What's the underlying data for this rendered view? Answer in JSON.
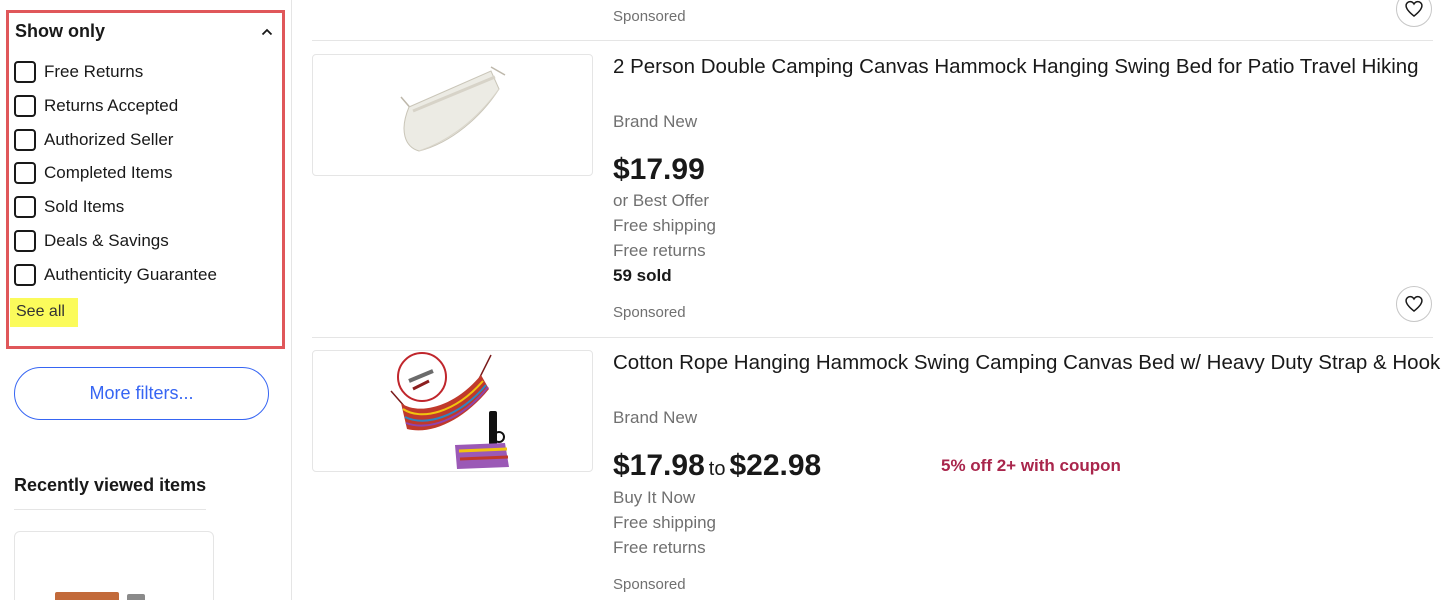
{
  "sidebar": {
    "filter_title": "Show only",
    "options": [
      {
        "label": "Free Returns",
        "checked": false
      },
      {
        "label": "Returns Accepted",
        "checked": false
      },
      {
        "label": "Authorized Seller",
        "checked": false
      },
      {
        "label": "Completed Items",
        "checked": false
      },
      {
        "label": "Sold Items",
        "checked": false
      },
      {
        "label": "Deals & Savings",
        "checked": false
      },
      {
        "label": "Authenticity Guarantee",
        "checked": false
      }
    ],
    "see_all": "See all",
    "more_filters": "More filters...",
    "recently_viewed_title": "Recently viewed items"
  },
  "listings": [
    {
      "sponsored": "Sponsored"
    },
    {
      "title": "2 Person Double Camping Canvas Hammock Hanging Swing Bed for Patio Travel Hiking",
      "condition": "Brand New",
      "price": "$17.99",
      "offer": "or Best Offer",
      "shipping": "Free shipping",
      "returns": "Free returns",
      "sold": "59 sold",
      "sponsored": "Sponsored"
    },
    {
      "title": "Cotton Rope Hanging Hammock Swing Camping Canvas Bed w/ Heavy Duty Strap & Hook",
      "condition": "Brand New",
      "price_low": "$17.98",
      "price_to": "to",
      "price_high": "$22.98",
      "buy_format": "Buy It Now",
      "shipping": "Free shipping",
      "returns": "Free returns",
      "coupon": "5% off 2+ with coupon",
      "sponsored": "Sponsored"
    }
  ],
  "colors": {
    "highlight_border": "#e0575a",
    "highlight_fill": "#fbfb5b",
    "link_blue": "#3665f3",
    "coupon_red": "#a9264c",
    "secondary_text": "#707070"
  },
  "icons": {
    "collapse": "chevron-up-icon",
    "favorite": "heart-icon"
  }
}
